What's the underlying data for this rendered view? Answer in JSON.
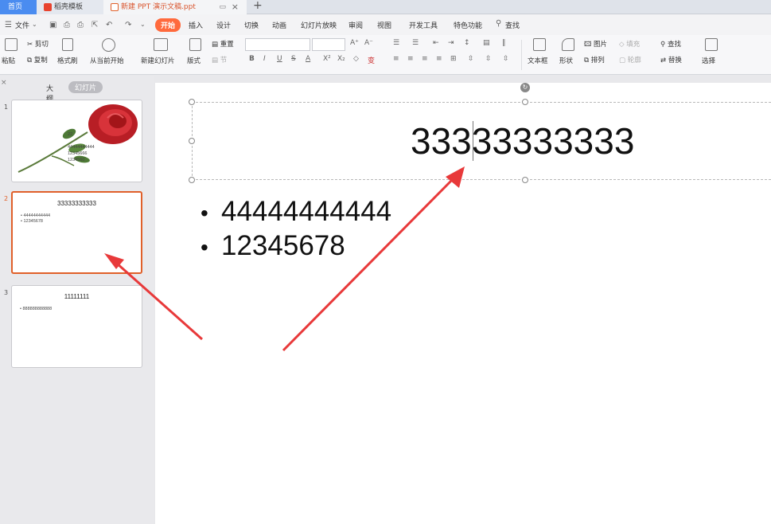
{
  "tabs": {
    "home": "首页",
    "template": "稻壳模板",
    "document": "新建 PPT 演示文稿.ppt"
  },
  "menu": {
    "file": "文件",
    "items": [
      "开始",
      "插入",
      "设计",
      "切换",
      "动画",
      "幻灯片放映",
      "审阅",
      "视图",
      "开发工具",
      "特色功能"
    ],
    "search": "查找"
  },
  "ribbon": {
    "paste": "粘贴",
    "cut": "剪切",
    "copy": "复制",
    "format_painter": "格式刷",
    "play_from_current": "从当前开始",
    "new_slide": "新建幻灯片",
    "layout": "版式",
    "reset": "重置",
    "section": "节",
    "text_box": "文本框",
    "shape": "形状",
    "picture": "图片",
    "fill": "填充",
    "arrange": "排列",
    "outline": "轮廓",
    "find": "查找",
    "replace": "替换",
    "select": "选择"
  },
  "left_panel": {
    "outline_tab": "大纲",
    "slides_tab": "幻灯片"
  },
  "slides": [
    {
      "number": "1",
      "title": "",
      "bullets": [
        "22",
        "44444444444",
        "12345666",
        "1234560"
      ]
    },
    {
      "number": "2",
      "title": "33333333333",
      "bullets": [
        "44444444444",
        "12345678"
      ]
    },
    {
      "number": "3",
      "title": "11111111",
      "bullets": [
        "888888888888"
      ]
    }
  ],
  "current_slide": {
    "title": "33333333333",
    "bullets": [
      "44444444444",
      "12345678"
    ]
  },
  "colors": {
    "accent": "#ff6a3d",
    "selection": "#e0602a",
    "home_tab": "#4a8cf0",
    "arrow": "#e8393a"
  }
}
